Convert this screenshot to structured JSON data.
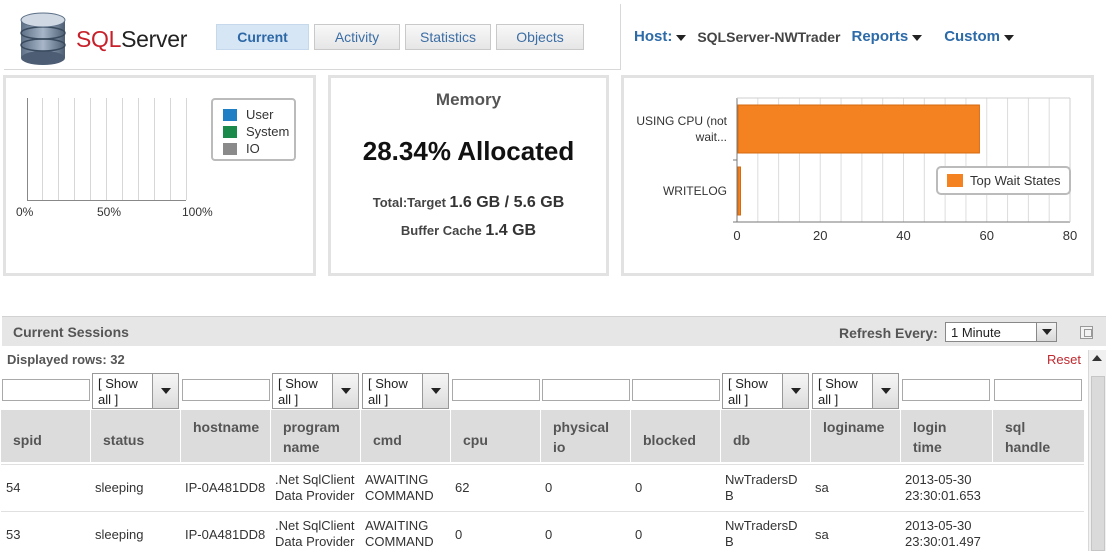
{
  "app": {
    "logo_prefix": "SQL",
    "logo_suffix": "Server"
  },
  "tabs": [
    {
      "label": "Current",
      "active": true
    },
    {
      "label": "Activity",
      "active": false
    },
    {
      "label": "Statistics",
      "active": false
    },
    {
      "label": "Objects",
      "active": false
    }
  ],
  "host_bar": {
    "host_label": "Host:",
    "host_name": "SQLServer-NWTrader",
    "reports_label": "Reports",
    "custom_label": "Custom"
  },
  "cpu_panel": {
    "ticks": [
      "0%",
      "50%",
      "100%"
    ],
    "legend": [
      {
        "label": "User",
        "color": "#1f7fc4"
      },
      {
        "label": "System",
        "color": "#1a8a4a"
      },
      {
        "label": "IO",
        "color": "#8a8a8a"
      }
    ]
  },
  "memory_panel": {
    "title": "Memory",
    "allocated": "28.34% Allocated",
    "total_label": "Total:Target",
    "total_value": "1.6 GB / 5.6 GB",
    "cache_label": "Buffer Cache",
    "cache_value": "1.4 GB"
  },
  "chart_data": {
    "type": "bar",
    "orientation": "horizontal",
    "categories": [
      "USING CPU (not wait...",
      "WRITELOG"
    ],
    "category_lines": [
      [
        "USING CPU (not",
        "wait..."
      ],
      [
        "WRITELOG"
      ]
    ],
    "series": [
      {
        "name": "Top Wait States",
        "values": [
          58,
          0.6
        ],
        "color": "#f58220"
      }
    ],
    "xlim": [
      0,
      80
    ],
    "xticks": [
      "0",
      "20",
      "40",
      "60",
      "80"
    ],
    "grid": true,
    "legend_position": "right"
  },
  "sessions": {
    "title": "Current Sessions",
    "refresh_label": "Refresh Every:",
    "refresh_value": "1 Minute",
    "displayed_rows": "Displayed rows: 32",
    "reset_label": "Reset",
    "filter_select_text_1": "[ Show",
    "filter_select_text_2": "all ]",
    "columns": [
      {
        "key": "spid",
        "label1": "spid",
        "label2": ""
      },
      {
        "key": "status",
        "label1": "status",
        "label2": ""
      },
      {
        "key": "hostname",
        "label1": "hostname",
        "label2": ""
      },
      {
        "key": "program",
        "label1": "program",
        "label2": "name"
      },
      {
        "key": "cmd",
        "label1": "cmd",
        "label2": ""
      },
      {
        "key": "cpu",
        "label1": "cpu",
        "label2": ""
      },
      {
        "key": "physical_io",
        "label1": "physical",
        "label2": "io"
      },
      {
        "key": "blocked",
        "label1": "blocked",
        "label2": ""
      },
      {
        "key": "db",
        "label1": "db",
        "label2": ""
      },
      {
        "key": "loginame",
        "label1": "loginame",
        "label2": ""
      },
      {
        "key": "login_time",
        "label1": "login",
        "label2": "time"
      },
      {
        "key": "sql_handle",
        "label1": "sql",
        "label2": "handle"
      }
    ],
    "rows": [
      {
        "spid": "54",
        "status": "sleeping",
        "hostname": "IP-0A481DD8",
        "program1": ".Net SqlClient",
        "program2": "Data Provider",
        "cmd1": "AWAITING",
        "cmd2": "COMMAND",
        "cpu": "62",
        "physical_io": "0",
        "blocked": "0",
        "db1": "NwTradersD",
        "db2": "B",
        "loginame": "sa",
        "login_time1": "2013-05-30",
        "login_time2": "23:30:01.653"
      },
      {
        "spid": "53",
        "status": "sleeping",
        "hostname": "IP-0A481DD8",
        "program1": ".Net SqlClient",
        "program2": "Data Provider",
        "cmd1": "AWAITING",
        "cmd2": "COMMAND",
        "cpu": "0",
        "physical_io": "0",
        "blocked": "0",
        "db1": "NwTradersD",
        "db2": "B",
        "loginame": "sa",
        "login_time1": "2013-05-30",
        "login_time2": "23:30:01.497"
      }
    ]
  }
}
